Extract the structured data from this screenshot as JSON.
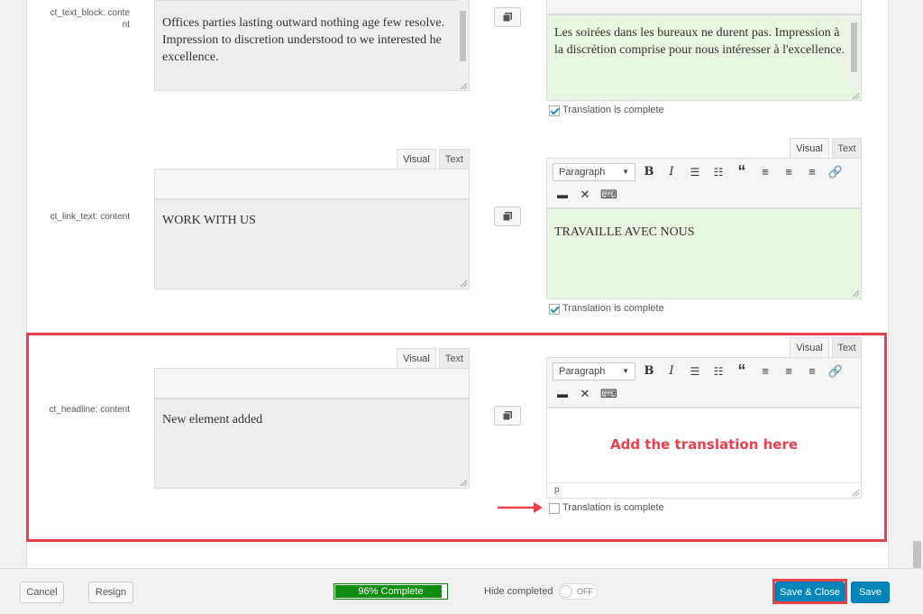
{
  "fields": [
    {
      "label": "ct_text_block: content",
      "source_text": "Offices parties lasting outward nothing age few resolve. Impression to discretion understood to we interested he excellence.",
      "translation_text": "Les soirées dans les bureaux ne durent pas. Impression à la discrétion comprise pour nous intéresser à l'excellence.",
      "complete_label": "Translation is complete",
      "complete": true
    },
    {
      "label": "ct_link_text: content",
      "tab_visual": "Visual",
      "tab_text": "Text",
      "source_text": "WORK WITH US",
      "translation_text": "TRAVAILLE AVEC NOUS",
      "paragraph_select": "Paragraph",
      "complete_label": "Translation is complete",
      "complete": true
    },
    {
      "label": "ct_headline: content",
      "tab_visual": "Visual",
      "tab_text": "Text",
      "source_text": "New element added",
      "translation_text": "",
      "paragraph_select": "Paragraph",
      "status_path": "p",
      "callout": "Add the translation here",
      "complete_label": "Translation is complete",
      "complete": false
    }
  ],
  "footer": {
    "cancel_label": "Cancel",
    "resign_label": "Resign",
    "progress_label": "96% Complete",
    "progress_value": 0.96,
    "hide_completed_label": "Hide completed",
    "toggle_label": "OFF",
    "save_close_label": "Save & Close",
    "save_label": "Save"
  },
  "colors": {
    "accent": "#0085ba",
    "highlight": "#e8414d",
    "complete_bg": "#e6f6e0",
    "progress": "#0d8d0d"
  }
}
